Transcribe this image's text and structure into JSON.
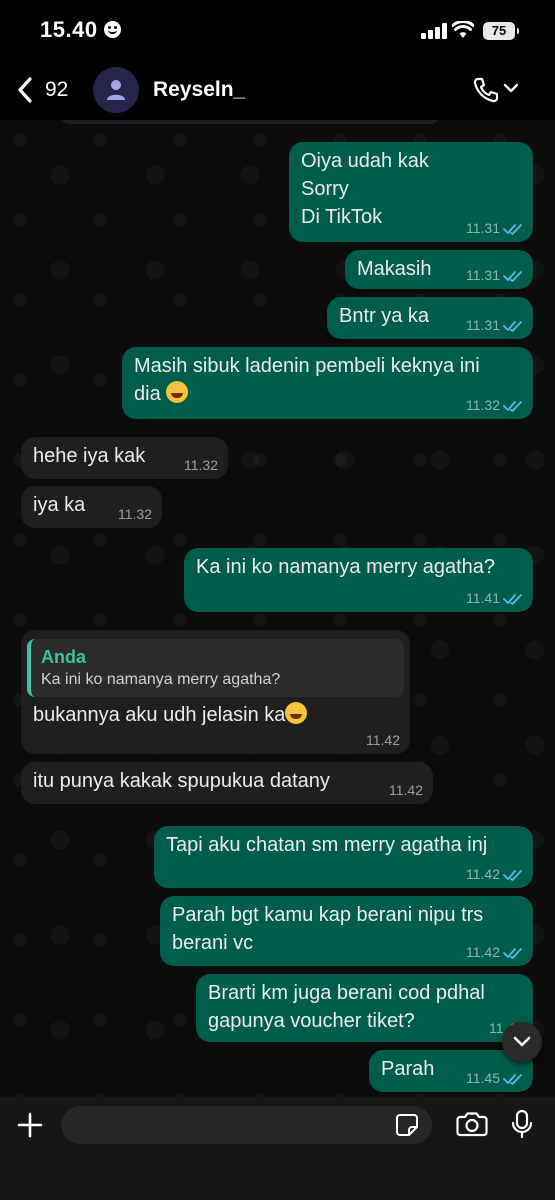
{
  "status_bar": {
    "time": "15.40",
    "battery": "75"
  },
  "header": {
    "unread_count": "92",
    "contact_name": "Reyseln_"
  },
  "messages": [
    {
      "dir": "out",
      "lines": [
        "Oiya udah kak",
        "Sorry",
        "Di TikTok"
      ],
      "time": "11.31"
    },
    {
      "dir": "out",
      "text": "Makasih",
      "time": "11.31"
    },
    {
      "dir": "out",
      "text": "Bntr ya ka",
      "time": "11.31"
    },
    {
      "dir": "out",
      "lines": [
        "Masih sibuk ladenin pembeli keknya ini",
        "dia"
      ],
      "time": "11.32"
    },
    {
      "dir": "in",
      "text": "hehe iya kak",
      "time": "11.32"
    },
    {
      "dir": "in",
      "text": "iya ka",
      "time": "11.32"
    },
    {
      "dir": "out",
      "text": "Ka ini ko namanya merry agatha?",
      "time": "11.41"
    },
    {
      "dir": "in",
      "quote_name": "Anda",
      "quote_text": "Ka ini ko namanya merry agatha?",
      "text": "bukannya aku udh jelasin ka",
      "time": "11.42"
    },
    {
      "dir": "in",
      "text": "itu punya kakak spupukua datany",
      "time": "11.42"
    },
    {
      "dir": "out",
      "text": "Tapi aku chatan sm merry agatha inj",
      "time": "11.42"
    },
    {
      "dir": "out",
      "lines": [
        "Parah bgt kamu kap berani nipu trs",
        "berani vc"
      ],
      "time": "11.42"
    },
    {
      "dir": "out",
      "lines": [
        "Brarti km juga berani cod pdhal",
        "gapunya voucher tiket?"
      ],
      "time": "11.43"
    },
    {
      "dir": "out",
      "text": "Parah",
      "time": "11.45"
    }
  ],
  "colors": {
    "outgoing": "#005c4b",
    "incoming": "#1f1f1f",
    "read_ticks": "#53bdeb",
    "quote_accent": "#3ac2a1"
  },
  "icons": [
    "smiley-icon",
    "signal-icon",
    "wifi-icon",
    "battery-icon",
    "back-chevron-icon",
    "avatar-person-icon",
    "phone-icon",
    "chevron-down-icon",
    "plus-icon",
    "sticker-icon",
    "camera-icon",
    "microphone-icon",
    "read-ticks-icon",
    "emoji-joy-icon",
    "emoji-sob-icon"
  ]
}
